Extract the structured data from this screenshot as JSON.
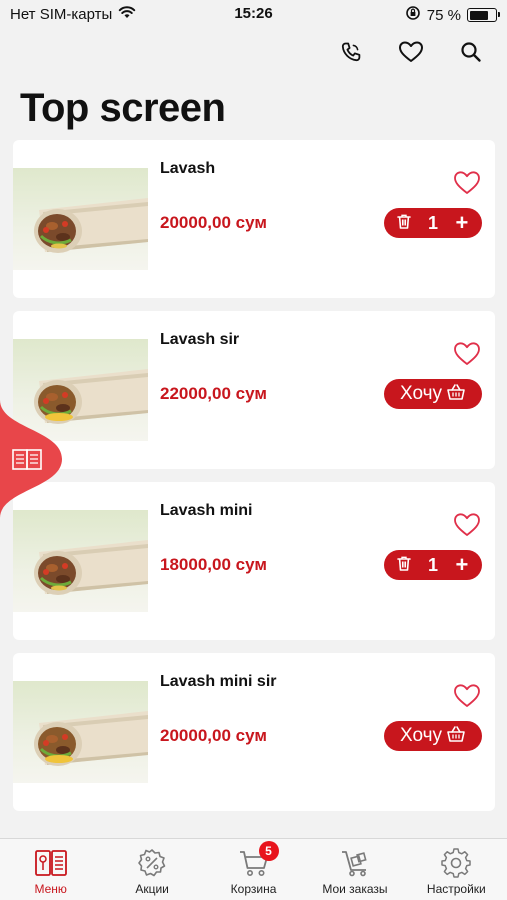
{
  "status_bar": {
    "carrier": "Нет SIM-карты",
    "time": "15:26",
    "battery": "75 %",
    "battery_level": 0.75
  },
  "header": {
    "title": "Top screen",
    "actions": [
      "phone-icon",
      "heart-icon",
      "search-icon"
    ]
  },
  "accent_color": "#c8161d",
  "products": [
    {
      "name": "Lavash",
      "price": "20000,00 сум",
      "in_cart": true,
      "quantity": "1",
      "image": "lavash-beef"
    },
    {
      "name": "Lavash sir",
      "price": "22000,00 сум",
      "in_cart": false,
      "want_label": "Хочу",
      "image": "lavash-cheese"
    },
    {
      "name": "Lavash mini",
      "price": "18000,00 сум",
      "in_cart": true,
      "quantity": "1",
      "image": "lavash-beef"
    },
    {
      "name": "Lavash mini sir",
      "price": "20000,00 сум",
      "in_cart": false,
      "want_label": "Хочу",
      "image": "lavash-cheese"
    }
  ],
  "bottom_nav": {
    "items": [
      {
        "label": "Меню",
        "icon": "menu-book-icon",
        "active": true
      },
      {
        "label": "Акции",
        "icon": "discount-icon",
        "active": false
      },
      {
        "label": "Корзина",
        "icon": "cart-icon",
        "active": false,
        "badge": "5"
      },
      {
        "label": "Мои заказы",
        "icon": "delivery-cart-icon",
        "active": false
      },
      {
        "label": "Настройки",
        "icon": "gear-icon",
        "active": false
      }
    ]
  }
}
